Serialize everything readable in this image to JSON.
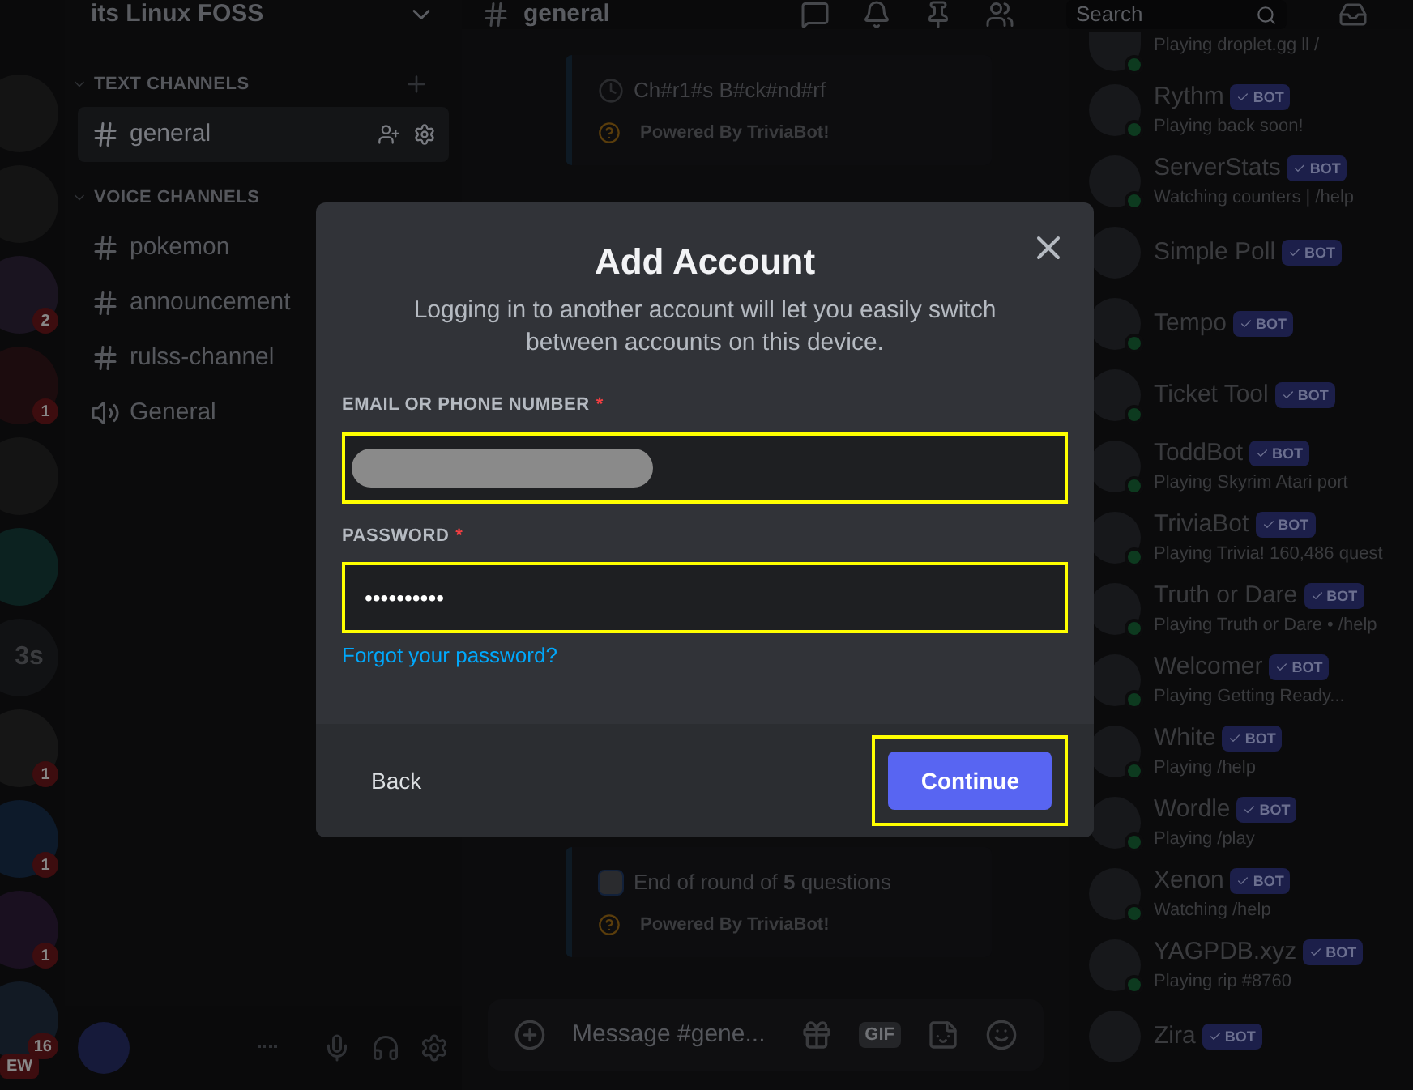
{
  "servers": [
    {
      "kind": "avatar"
    },
    {
      "kind": "avatar"
    },
    {
      "kind": "avatar",
      "badge": "2"
    },
    {
      "kind": "avatar",
      "badge": "1"
    },
    {
      "kind": "avatar"
    },
    {
      "kind": "avatar"
    },
    {
      "kind": "initials",
      "label": "3s"
    },
    {
      "kind": "avatar",
      "badge": "1"
    },
    {
      "kind": "avatar",
      "badge": "1"
    },
    {
      "kind": "avatar",
      "badge": "1"
    },
    {
      "kind": "avatar",
      "badge": "16",
      "pill": "EW"
    }
  ],
  "sidebar": {
    "server_name": "its Linux FOSS",
    "sections": [
      {
        "title": "TEXT CHANNELS",
        "channels": [
          {
            "kind": "text",
            "name": "general",
            "selected": true
          }
        ]
      },
      {
        "title": "VOICE CHANNELS",
        "channels": [
          {
            "kind": "text",
            "name": "pokemon",
            "selected": false
          },
          {
            "kind": "text",
            "name": "announcement",
            "selected": false
          },
          {
            "kind": "text",
            "name": "rulss-channel",
            "selected": false
          },
          {
            "kind": "voice",
            "name": "General",
            "selected": false
          }
        ]
      }
    ]
  },
  "chat": {
    "channel": "general",
    "search": {
      "placeholder": "Search"
    },
    "embeds": [
      {
        "line": "Ch#r1#s B#ck#nd#rf",
        "footer": "Powered By TriviaBot!"
      },
      {
        "line": "End of round of **5** questions",
        "footer": "Powered By TriviaBot!"
      }
    ],
    "composer": {
      "placeholder": "Message #gene...",
      "gif": "GIF"
    }
  },
  "members": [
    {
      "status": "Playing droplet.gg ll /",
      "online": true
    },
    {
      "name": "Rythm",
      "status": "Playing back soon!",
      "online": true,
      "badge": "BOT"
    },
    {
      "name": "ServerStats",
      "status": "Watching counters | /help",
      "online": true,
      "badge": "BOT"
    },
    {
      "name": "Simple Poll",
      "online": false,
      "badge": "BOT"
    },
    {
      "name": "Tempo",
      "online": true,
      "badge": "BOT"
    },
    {
      "name": "Ticket Tool",
      "online": true,
      "badge": "BOT"
    },
    {
      "name": "ToddBot",
      "status": "Playing Skyrim Atari port",
      "online": true,
      "badge": "BOT"
    },
    {
      "name": "TriviaBot",
      "status": "Playing Trivia! 160,486 quest",
      "online": true,
      "badge": "BOT"
    },
    {
      "name": "Truth or Dare",
      "status": "Playing Truth or Dare • /help",
      "online": true,
      "badge": "BOT"
    },
    {
      "name": "Welcomer",
      "status": "Playing Getting Ready...",
      "online": true,
      "badge": "BOT"
    },
    {
      "name": "White",
      "status": "Playing /help",
      "online": true,
      "badge": "BOT"
    },
    {
      "name": "Wordle",
      "status": "Playing /play",
      "online": true,
      "badge": "BOT"
    },
    {
      "name": "Xenon",
      "status": "Watching /help",
      "online": true,
      "badge": "BOT"
    },
    {
      "name": "YAGPDB.xyz",
      "status": "Playing rip #8760",
      "online": true,
      "badge": "BOT"
    },
    {
      "name": "Zira",
      "online": false,
      "badge": "BOT"
    }
  ],
  "dialog": {
    "title": "Add Account",
    "description": "Logging in to another account will let you easily switch between accounts on this device.",
    "fields": [
      {
        "kind": "redacted",
        "label": "EMAIL OR PHONE NUMBER",
        "required": "*",
        "highlighted": true
      },
      {
        "kind": "password",
        "label": "PASSWORD",
        "required": "*",
        "value": "••••••••••",
        "highlighted": true
      }
    ],
    "link": "Forgot your password?",
    "buttons": [
      {
        "kind": "plain",
        "label": "Back",
        "highlighted": false
      },
      {
        "kind": "primary",
        "label": "Continue",
        "highlighted": true
      }
    ]
  }
}
